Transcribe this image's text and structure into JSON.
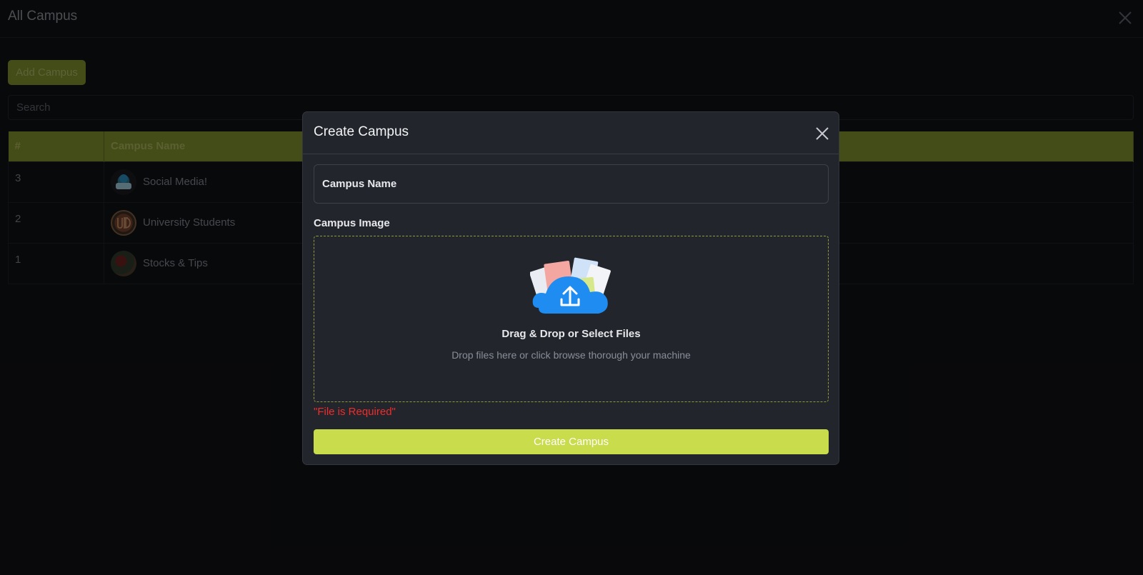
{
  "page": {
    "title": "All Campus",
    "add_button": "Add Campus",
    "search_placeholder": "Search"
  },
  "table": {
    "headers": [
      "#",
      "Campus Name"
    ],
    "rows": [
      {
        "id": "3",
        "name": "Social Media!",
        "avatar": "social-media-logo"
      },
      {
        "id": "2",
        "name": "University Students",
        "avatar": "utd-logo"
      },
      {
        "id": "1",
        "name": "Stocks & Tips",
        "avatar": "stocks-tips-logo"
      }
    ]
  },
  "modal": {
    "title": "Create Campus",
    "name_placeholder": "Campus Name",
    "image_label": "Campus Image",
    "dropzone_title": "Drag & Drop or Select Files",
    "dropzone_subtitle": "Drop files here or click browse thorough your machine",
    "error": "\"File is Required\"",
    "submit": "Create Campus"
  },
  "colors": {
    "accent": "#c9dc4b",
    "header_bg": "#7c8a2a",
    "error": "#f02c2c",
    "modal_bg": "#22252b",
    "page_bg": "#101115"
  },
  "icons": [
    "close-icon",
    "upload-cloud-icon"
  ]
}
